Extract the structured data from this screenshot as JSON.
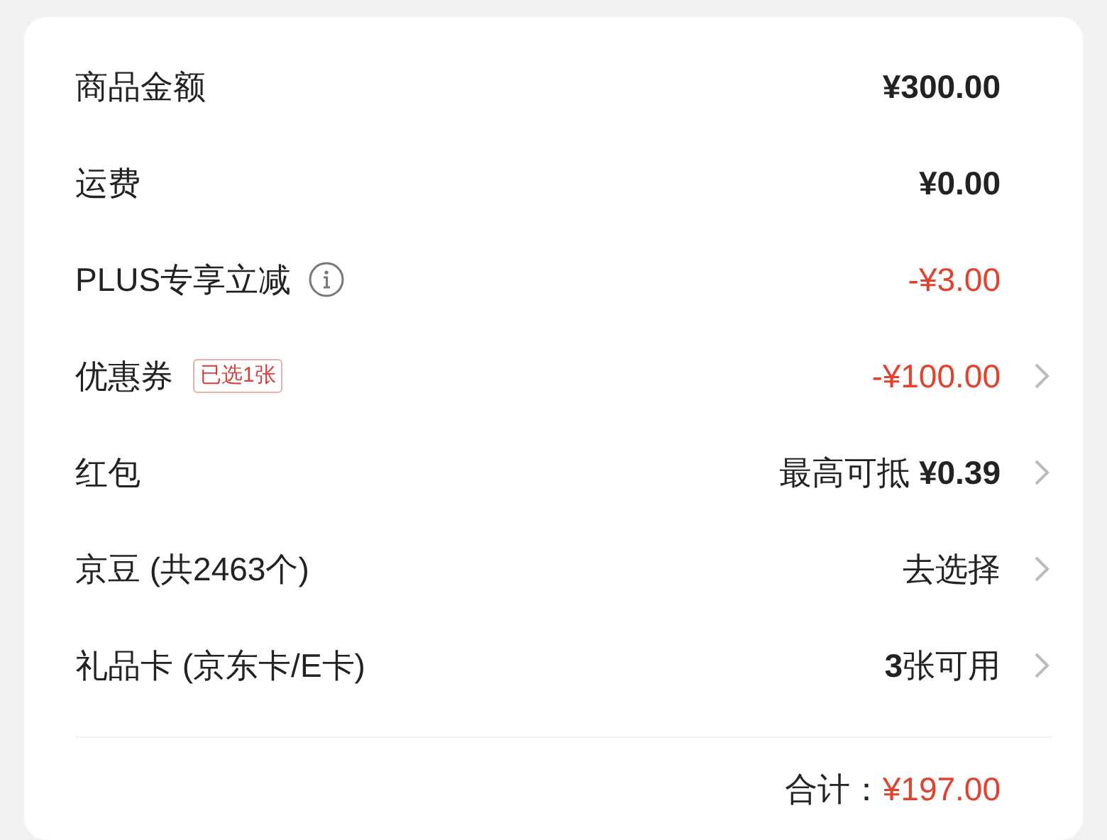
{
  "rows": [
    {
      "label": "商品金额",
      "value": "¥300.00",
      "value_bold": true,
      "discount": false,
      "arrow": false
    },
    {
      "label": "运费",
      "value": "¥0.00",
      "value_bold": true,
      "discount": false,
      "arrow": false
    },
    {
      "label": "PLUS专享立减",
      "info": true,
      "value": "-¥3.00",
      "value_bold": false,
      "discount": true,
      "arrow": false
    },
    {
      "label": "优惠券",
      "badge": "已选1张",
      "value": "-¥100.00",
      "value_bold": false,
      "discount": true,
      "arrow": true
    },
    {
      "label": "红包",
      "value": "最高可抵 **¥0.39**",
      "value_bold": false,
      "discount": false,
      "arrow": true
    },
    {
      "label": "京豆 (共2463个)",
      "value": "去选择",
      "value_bold": false,
      "discount": false,
      "arrow": true
    },
    {
      "label": "礼品卡 (京东卡/E卡)",
      "value": "**3**张可用",
      "value_bold": false,
      "discount": false,
      "arrow": true
    }
  ],
  "total": {
    "label": "合计：",
    "amount": "¥197.00"
  }
}
